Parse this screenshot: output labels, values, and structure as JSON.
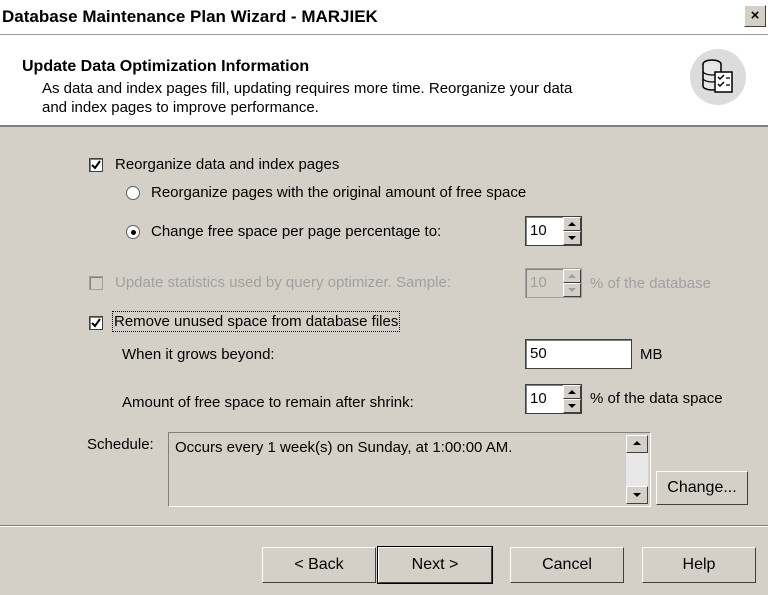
{
  "window": {
    "title": "Database Maintenance Plan Wizard - MARJIEK",
    "close_glyph": "×"
  },
  "header": {
    "title": "Update Data Optimization Information",
    "description_line1": "As data and index pages fill, updating requires more time. Reorganize your data",
    "description_line2": "and index pages to improve performance.",
    "icon": "database-checklist-icon"
  },
  "options": {
    "reorganize": {
      "label": "Reorganize data and index pages",
      "checked": true,
      "radio_original": {
        "label": "Reorganize pages with the original amount of free space",
        "selected": false
      },
      "radio_change": {
        "label": "Change free space per page percentage to:",
        "selected": true,
        "value": "10"
      }
    },
    "update_stats": {
      "label": "Update statistics used by query optimizer. Sample:",
      "checked": false,
      "enabled": false,
      "value": "10",
      "suffix": "% of the database"
    },
    "remove_unused": {
      "label": "Remove unused space from database files",
      "checked": true,
      "grows_label": "When it grows beyond:",
      "grows_value": "50",
      "grows_unit": "MB",
      "remain_label": "Amount of free space to remain after shrink:",
      "remain_value": "10",
      "remain_suffix": "% of the data space"
    }
  },
  "schedule": {
    "label": "Schedule:",
    "text": "Occurs every 1 week(s) on Sunday, at 1:00:00 AM.",
    "change_button": "Change..."
  },
  "buttons": {
    "back": "< Back",
    "next": "Next >",
    "cancel": "Cancel",
    "help": "Help"
  }
}
